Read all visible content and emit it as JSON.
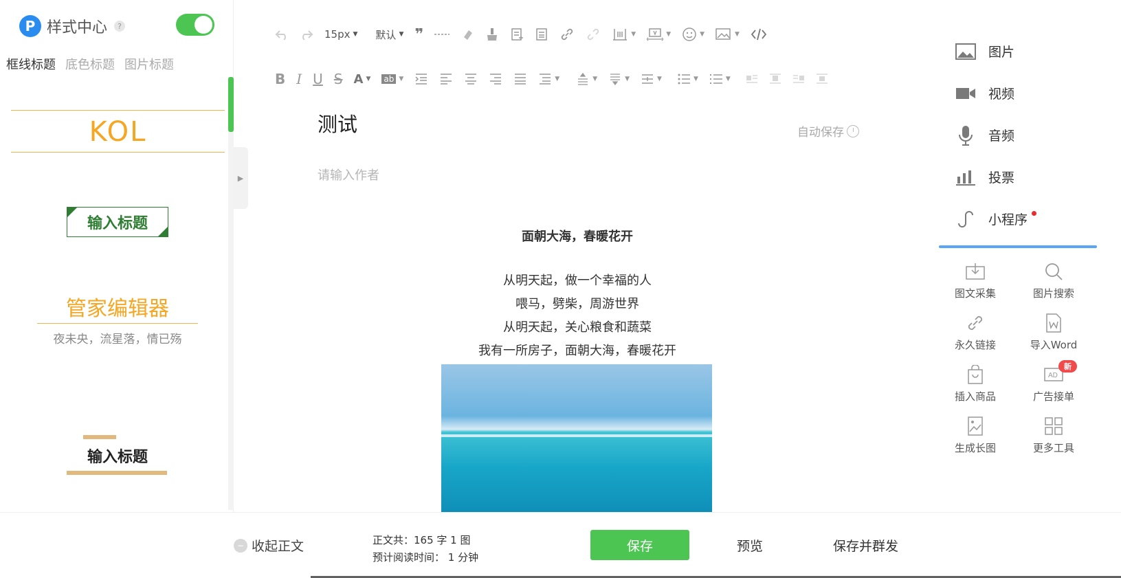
{
  "style_center": {
    "title": "样式中心",
    "logo": "P",
    "help": "?",
    "tabs": [
      "框线标题",
      "底色标题",
      "图片标题"
    ],
    "templates": {
      "kol": "KOL",
      "boxed_title": "输入标题",
      "gjb_title": "管家编辑器",
      "gjb_sub": "夜未央，流星落，情已殇",
      "bar_title": "输入标题"
    }
  },
  "toolbar": {
    "font_size": "15px",
    "font_family": "默认"
  },
  "editor": {
    "title": "测试",
    "autosave": "自动保存",
    "author_placeholder": "请输入作者",
    "article_heading": "面朝大海，春暖花开",
    "article_lines": [
      "从明天起，做一个幸福的人",
      "喂马，劈柴，周游世界",
      "从明天起，关心粮食和蔬菜",
      "我有一所房子，面朝大海，春暖花开"
    ]
  },
  "right_panel": {
    "media": [
      {
        "label": "图片",
        "icon": "image-icon"
      },
      {
        "label": "视频",
        "icon": "video-icon"
      },
      {
        "label": "音频",
        "icon": "microphone-icon"
      },
      {
        "label": "投票",
        "icon": "vote-bars-icon"
      },
      {
        "label": "小程序",
        "icon": "mini-program-icon"
      }
    ],
    "tools": [
      {
        "label": "图文采集",
        "icon": "download-icon"
      },
      {
        "label": "图片搜索",
        "icon": "search-icon"
      },
      {
        "label": "永久链接",
        "icon": "link-icon"
      },
      {
        "label": "导入Word",
        "icon": "word-doc-icon"
      },
      {
        "label": "插入商品",
        "icon": "shopping-bag-icon"
      },
      {
        "label": "广告接单",
        "icon": "ad-icon",
        "badge": "新"
      },
      {
        "label": "生成长图",
        "icon": "long-image-icon"
      },
      {
        "label": "更多工具",
        "icon": "grid-icon"
      }
    ]
  },
  "bottom_bar": {
    "collapse": "收起正文",
    "stats_line1": "正文共：165 字 1 图",
    "stats_line2": "预计阅读时间：  1 分钟",
    "save": "保存",
    "preview": "预览",
    "save_and_mass": "保存并群发"
  },
  "colors": {
    "accent_green": "#4cc552",
    "logo_blue": "#2b8cf0",
    "kol_orange": "#f5a623",
    "boxed_green": "#2e7d32",
    "badge_red": "#f04a4a"
  }
}
